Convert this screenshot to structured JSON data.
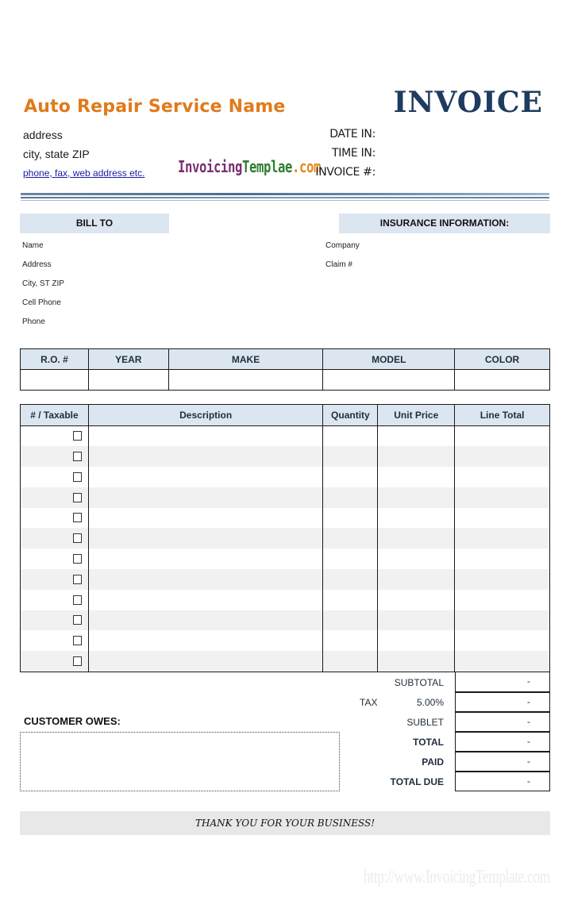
{
  "header": {
    "company_name": "Auto Repair Service Name",
    "address": "address",
    "city_state_zip": "city, state ZIP",
    "contact_link": "phone, fax, web address etc.",
    "title": "INVOICE",
    "date_in_label": "DATE IN:",
    "time_in_label": "TIME IN:",
    "invoice_no_label": "INVOICE #:"
  },
  "logo": {
    "parts": [
      {
        "text": "Invoicing",
        "color": "#7b2d6e"
      },
      {
        "text": "Templae",
        "color": "#2e7d32"
      },
      {
        "text": ".com",
        "color": "#e08a1e"
      }
    ]
  },
  "bill_to": {
    "heading": "BILL TO",
    "fields": [
      "Name",
      "Address",
      "City, ST ZIP",
      "Cell Phone",
      "Phone"
    ]
  },
  "insurance": {
    "heading": "INSURANCE INFORMATION:",
    "fields": [
      "Company",
      "Claim #"
    ]
  },
  "vehicle_table": {
    "columns": [
      "R.O. #",
      "YEAR",
      "MAKE",
      "MODEL",
      "COLOR"
    ],
    "row": [
      "",
      "",
      "",
      "",
      ""
    ]
  },
  "items_table": {
    "columns": [
      "# / Taxable",
      "Description",
      "Quantity",
      "Unit Price",
      "Line Total"
    ],
    "row_count": 12,
    "taxable_checked": [
      false,
      false,
      false,
      false,
      false,
      false,
      false,
      false,
      false,
      false,
      false,
      false
    ]
  },
  "summary": {
    "subtotal_label": "SUBTOTAL",
    "tax_label": "TAX",
    "tax_rate": "5.00%",
    "sublet_label": "SUBLET",
    "total_label": "TOTAL",
    "paid_label": "PAID",
    "total_due_label": "TOTAL DUE",
    "subtotal_value": "-",
    "tax_value": "-",
    "sublet_value": "-",
    "total_value": "-",
    "paid_value": "-",
    "total_due_value": "-"
  },
  "customer_owes": {
    "label": "CUSTOMER OWES:",
    "value": ""
  },
  "footer": {
    "thanks": "THANK YOU FOR YOUR BUSINESS!",
    "watermark": "http://www.InvoicingTemplate.com"
  }
}
